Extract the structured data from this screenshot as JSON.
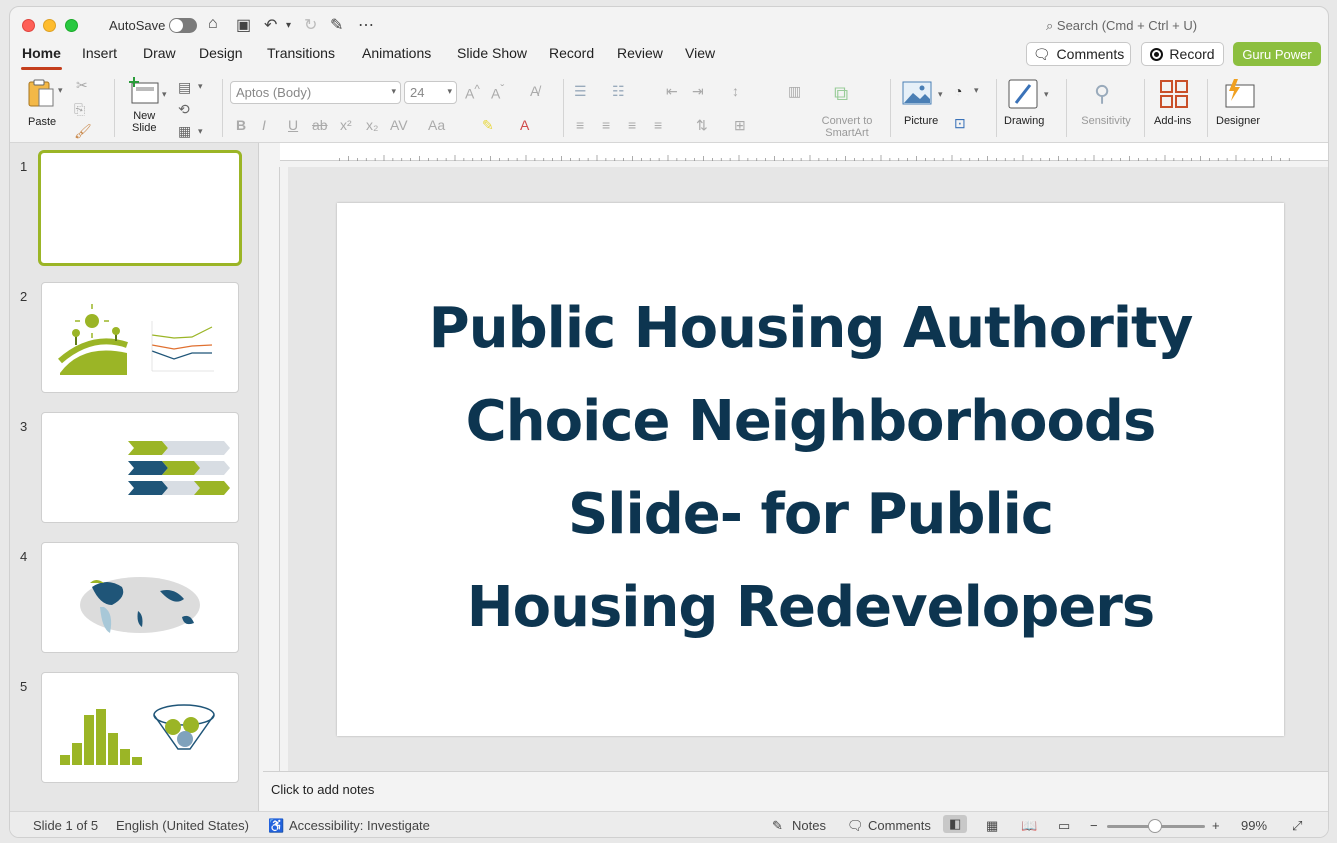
{
  "titlebar": {
    "autosave_label": "AutoSave",
    "search_placeholder": "Search (Cmd + Ctrl + U)"
  },
  "tabs": [
    "Home",
    "Insert",
    "Draw",
    "Design",
    "Transitions",
    "Animations",
    "Slide Show",
    "Record",
    "Review",
    "View"
  ],
  "header_buttons": {
    "comments": "Comments",
    "record": "Record",
    "guru": "Guru Power"
  },
  "ribbon": {
    "paste": "Paste",
    "new_slide": "New\nSlide",
    "font_name": "Aptos (Body)",
    "font_size": "24",
    "convert_smartart": "Convert to\nSmartArt",
    "picture": "Picture",
    "drawing": "Drawing",
    "sensitivity": "Sensitivity",
    "addins": "Add-ins",
    "designer": "Designer"
  },
  "thumbnails": [
    "1",
    "2",
    "3",
    "4",
    "5"
  ],
  "slide": {
    "title_lines": [
      "Public Housing Authority",
      "Choice Neighborhoods",
      "Slide- for Public",
      "Housing Redevelopers"
    ]
  },
  "notes_placeholder": "Click to add notes",
  "statusbar": {
    "slide_of": "Slide 1 of 5",
    "language": "English (United States)",
    "accessibility": "Accessibility: Investigate",
    "notes": "Notes",
    "comments": "Comments",
    "zoom": "99%"
  },
  "colors": {
    "accent_tab_underline": "#c43e1c",
    "title_text": "#0d3550",
    "selected_thumb_border": "#9bb526",
    "guru_button": "#8cbf3f"
  }
}
